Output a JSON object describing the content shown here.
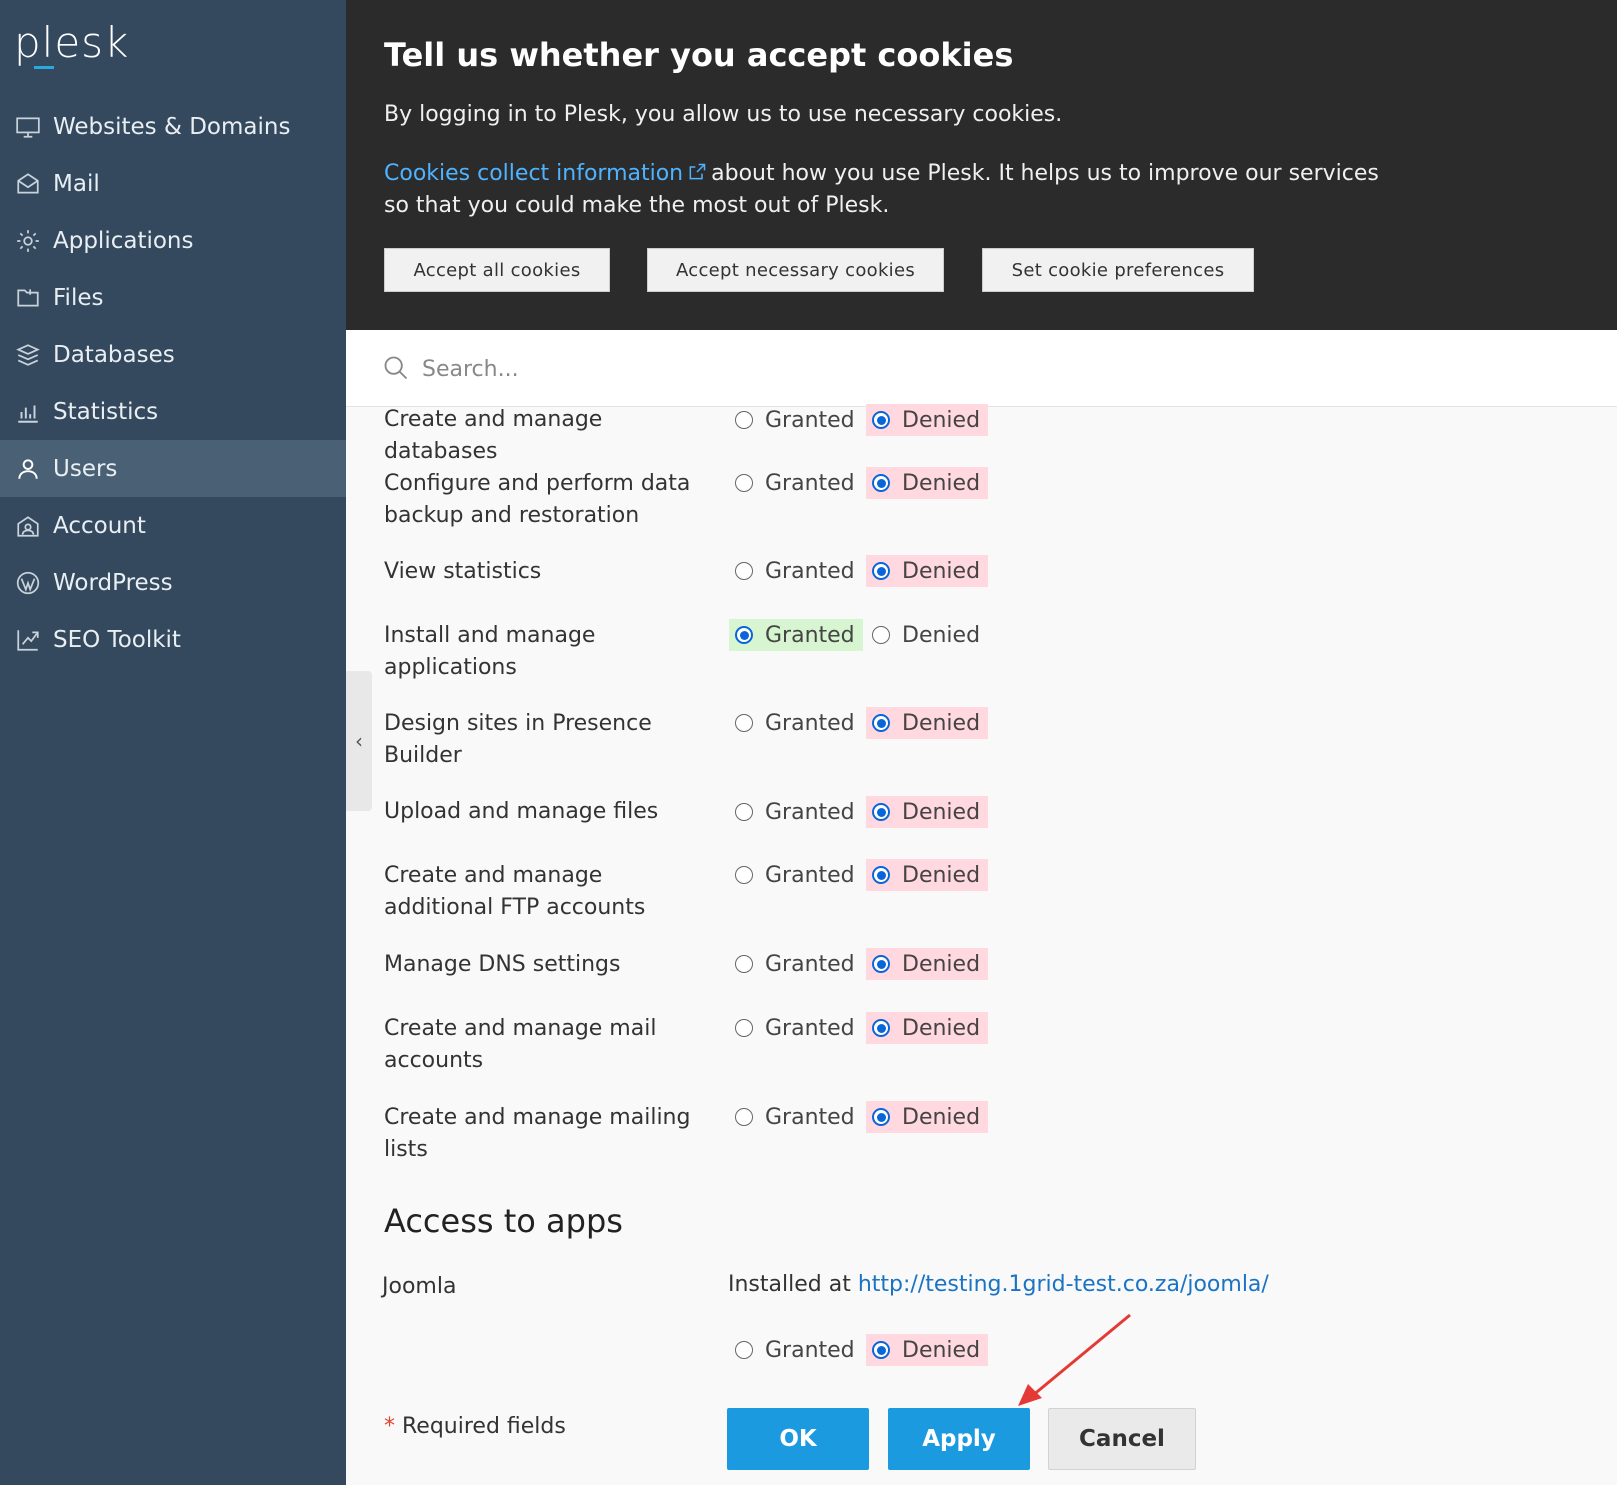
{
  "sidebar": {
    "logo": "plesk",
    "items": [
      {
        "label": "Websites & Domains",
        "icon": "monitor-icon"
      },
      {
        "label": "Mail",
        "icon": "mail-icon"
      },
      {
        "label": "Applications",
        "icon": "gear-icon"
      },
      {
        "label": "Files",
        "icon": "folder-icon"
      },
      {
        "label": "Databases",
        "icon": "database-icon"
      },
      {
        "label": "Statistics",
        "icon": "bar-chart-icon"
      },
      {
        "label": "Users",
        "icon": "user-icon",
        "active": true
      },
      {
        "label": "Account",
        "icon": "account-icon"
      },
      {
        "label": "WordPress",
        "icon": "wordpress-icon"
      },
      {
        "label": "SEO Toolkit",
        "icon": "seo-chart-icon"
      }
    ]
  },
  "cookie_banner": {
    "title": "Tell us whether you accept cookies",
    "text1": "By logging in to Plesk, you allow us to use necessary cookies.",
    "link_text": "Cookies collect information",
    "text2_rest": "about how you use Plesk. It helps us to improve our services so that you could make the most out of Plesk.",
    "buttons": {
      "accept_all": "Accept all cookies",
      "accept_necessary": "Accept necessary cookies",
      "preferences": "Set cookie preferences"
    }
  },
  "search": {
    "placeholder": "Search..."
  },
  "permissions": [
    {
      "label": "Create and manage databases",
      "value": "Denied"
    },
    {
      "label": "Configure and perform data backup and restoration",
      "value": "Denied"
    },
    {
      "label": "View statistics",
      "value": "Denied"
    },
    {
      "label": "Install and manage applications",
      "value": "Granted"
    },
    {
      "label": "Design sites in Presence Builder",
      "value": "Denied"
    },
    {
      "label": "Upload and manage files",
      "value": "Denied"
    },
    {
      "label": "Create and manage additional FTP accounts",
      "value": "Denied"
    },
    {
      "label": "Manage DNS settings",
      "value": "Denied"
    },
    {
      "label": "Create and manage mail accounts",
      "value": "Denied"
    },
    {
      "label": "Create and manage mailing lists",
      "value": "Denied"
    }
  ],
  "radio_labels": {
    "granted": "Granted",
    "denied": "Denied"
  },
  "access_to_apps": {
    "title": "Access to apps",
    "app_name": "Joomla",
    "installed_prefix": "Installed at",
    "installed_url": "http://testing.1grid-test.co.za/joomla/",
    "value": "Denied"
  },
  "footer": {
    "required_star": "*",
    "required_text": "Required fields",
    "ok": "OK",
    "apply": "Apply",
    "cancel": "Cancel"
  },
  "colors": {
    "sidebar_bg": "#34495e",
    "banner_bg": "#2b2b2b",
    "primary_button": "#1c9ae0",
    "denied_highlight": "#ffd9df",
    "granted_highlight": "#d6f5d0",
    "annotation_arrow": "#e53935"
  }
}
